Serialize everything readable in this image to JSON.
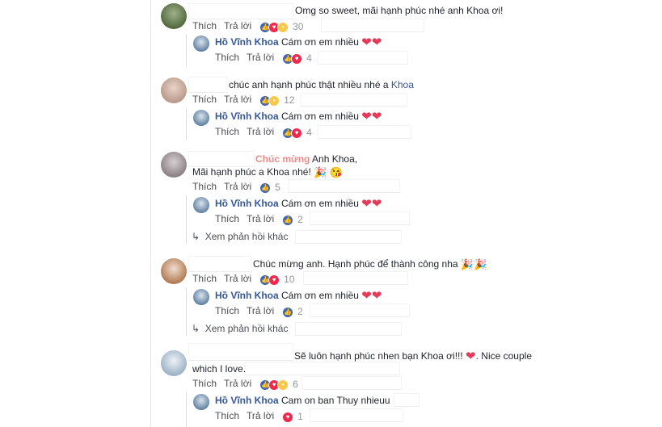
{
  "actions": {
    "like": "Thích",
    "reply": "Trả lời"
  },
  "comments": [
    {
      "text": "Omg so sweet, mãi hạnh phúc nhé anh Khoa ơi!",
      "count": "30",
      "reply": {
        "name": "Hồ Vĩnh Khoa",
        "text": "Cám ơn em nhiều",
        "count": "4"
      }
    },
    {
      "text": "chúc anh hạnh phúc thật nhiều nhé a",
      "text_link": "Khoa",
      "count": "12",
      "reply": {
        "name": "Hồ Vĩnh Khoa",
        "text": "Cám ơn em nhiều",
        "count": "4"
      }
    },
    {
      "text_highlight": "Chúc mừng",
      "text": "Anh Khoa,",
      "text_line2": "Mãi hạnh phúc a Khoa nhé!",
      "count": "5",
      "reply": {
        "name": "Hồ Vĩnh Khoa",
        "text": "Cám ơn em nhiều",
        "count": "2"
      },
      "more": "Xem phản hồi khác"
    },
    {
      "text": "Chúc mừng anh. Hạnh phúc để thành công nha",
      "count": "10",
      "reply": {
        "name": "Hồ Vĩnh Khoa",
        "text": "Cám ơn em nhiều",
        "count": "2"
      },
      "more": "Xem phản hồi khác"
    },
    {
      "text": "Sẽ luôn hạnh phúc nhen bạn Khoa ơi!!!",
      "text_after": ". Nice couple",
      "text_line2": "which I love.",
      "count": "6",
      "reply": {
        "name": "Hồ Vĩnh Khoa",
        "text": "Cam on ban Thuy nhieuu",
        "count": "1"
      }
    }
  ],
  "colors": {
    "name": "#365899",
    "like": "#4267b2",
    "love": "#f0284a",
    "highlight": "#f08a8a"
  },
  "icons": [
    "like-icon",
    "love-icon",
    "wow-icon",
    "sad-icon",
    "heart-icon",
    "reply-arrow-icon",
    "party-popper-icon"
  ]
}
